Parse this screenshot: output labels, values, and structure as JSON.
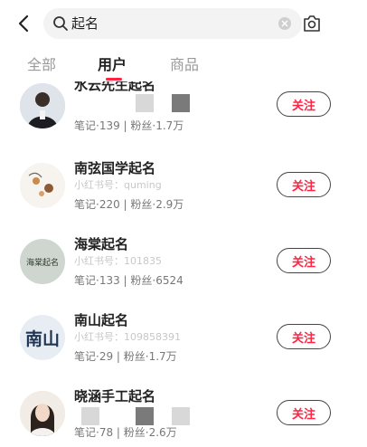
{
  "search": {
    "query": "起名"
  },
  "tabs": [
    {
      "label": "全部",
      "active": false
    },
    {
      "label": "用户",
      "active": true
    },
    {
      "label": "商品",
      "active": false
    }
  ],
  "accent_color": "#ff2442",
  "users": [
    {
      "name": "水云先生起名",
      "meta": "笔记·139 | 粉丝·1.7万",
      "follow_label": "关注"
    },
    {
      "name": "南弦国学起名",
      "meta": "笔记·220 | 粉丝·2.9万",
      "follow_label": "关注"
    },
    {
      "name": "海棠起名",
      "meta": "笔记·133 | 粉丝·6524",
      "follow_label": "关注"
    },
    {
      "name": "南山起名",
      "meta": "笔记·29 | 粉丝·1.7万",
      "follow_label": "关注"
    },
    {
      "name": "晓涵手工起名",
      "meta": "笔记·78 | 粉丝·2.6万",
      "follow_label": "关注"
    }
  ],
  "avatars": {
    "u3": "海棠起名",
    "u4": "南山"
  },
  "partial_ids": {
    "u2": "小红书号：quming",
    "u3": "小红书号：101835",
    "u4": "小红书号：109858391"
  }
}
